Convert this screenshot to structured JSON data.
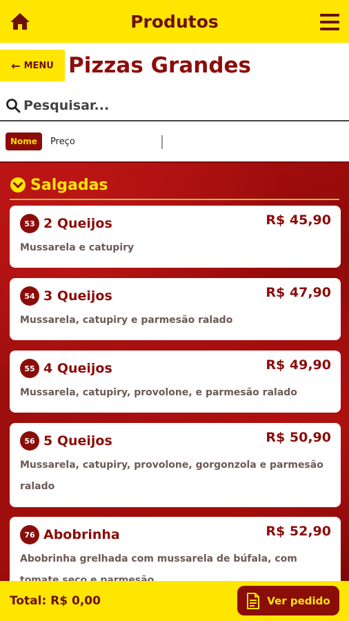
{
  "header": {
    "title": "Produtos",
    "home_icon": "home-icon",
    "menu_icon": "hamburger-menu-icon"
  },
  "subheader": {
    "back_label": "MENU",
    "back_icon": "arrow-left-icon",
    "page_title": "Pizzas Grandes"
  },
  "search": {
    "placeholder": "Pesquisar...",
    "value": "",
    "icon": "search-icon"
  },
  "sort": {
    "options": [
      "Nome",
      "Preço"
    ],
    "selected": "Nome"
  },
  "category": {
    "title": "Salgadas",
    "icon": "chevron-down-circle-icon"
  },
  "items": [
    {
      "number": "53",
      "name": "2 Queijos",
      "price": "R$ 45,90",
      "description": "Mussarela e catupiry"
    },
    {
      "number": "54",
      "name": "3 Queijos",
      "price": "R$ 47,90",
      "description": "Mussarela, catupiry e parmesão ralado"
    },
    {
      "number": "55",
      "name": "4 Queijos",
      "price": "R$ 49,90",
      "description": "Mussarela, catupiry, provolone, e parmesão ralado"
    },
    {
      "number": "56",
      "name": "5 Queijos",
      "price": "R$ 50,90",
      "description": "Mussarela, catupiry, provolone, gorgonzola e parmesão ralado"
    },
    {
      "number": "76",
      "name": "Abobrinha",
      "price": "R$ 52,90",
      "description": "Abobrinha grelhada com mussarela de búfala, com tomate seco e parmesão"
    }
  ],
  "footer": {
    "total": "Total: R$ 0,00",
    "order_label": "Ver pedido",
    "order_icon": "document-icon"
  },
  "colors": {
    "yellow": "#ffe600",
    "dark_red": "#8b0d0a",
    "text_gray": "#6b5a55"
  }
}
